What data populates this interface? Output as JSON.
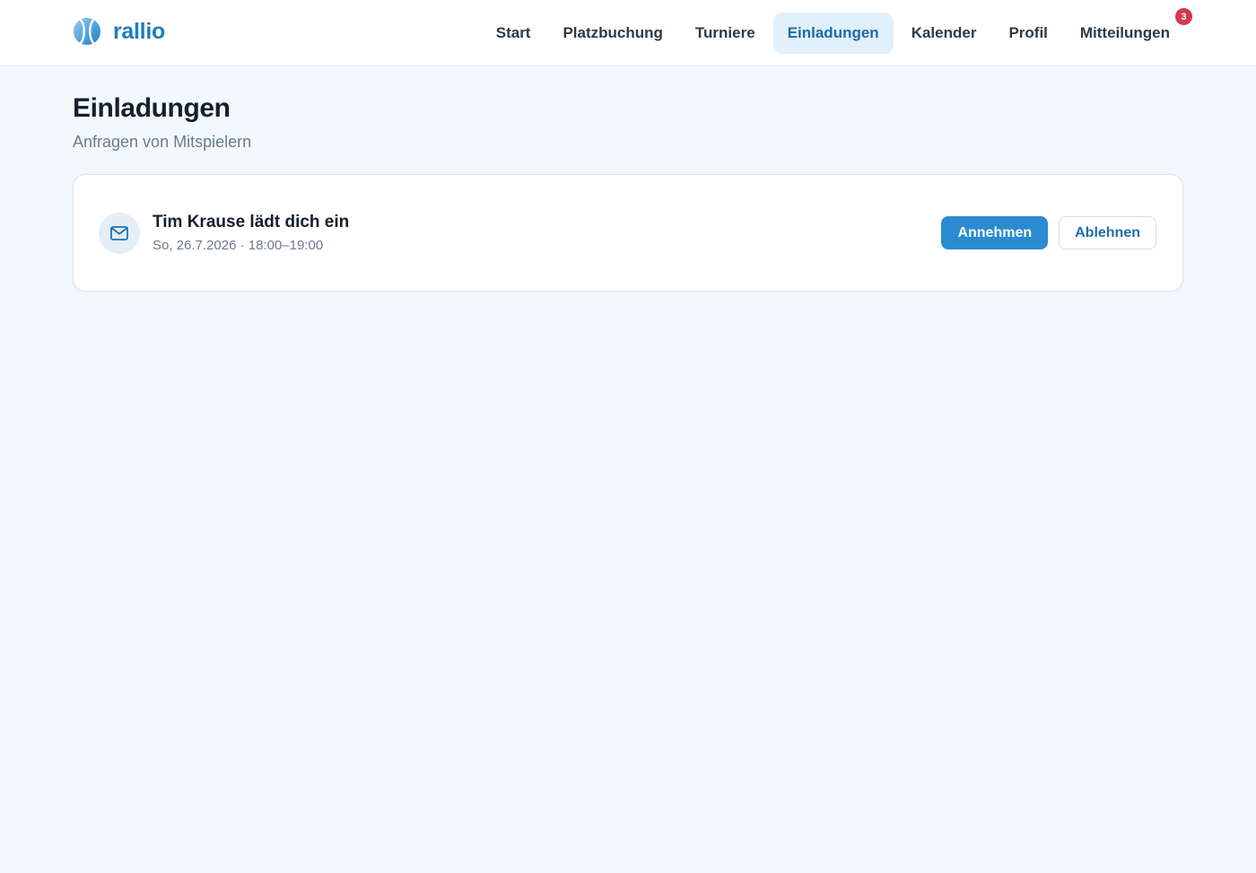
{
  "brand": {
    "name": "rallio",
    "logo_icon": "tennis-ball-icon",
    "accent_color": "#1f7cc2"
  },
  "nav": {
    "items": [
      {
        "label": "Start",
        "active": false
      },
      {
        "label": "Platzbuchung",
        "active": false
      },
      {
        "label": "Turniere",
        "active": false
      },
      {
        "label": "Einladungen",
        "active": true
      },
      {
        "label": "Kalender",
        "active": false
      },
      {
        "label": "Profil",
        "active": false
      },
      {
        "label": "Mitteilungen",
        "active": false,
        "badge": "3"
      }
    ],
    "active_bg": "#e2f0fb",
    "badge_color": "#d3394c"
  },
  "page": {
    "title": "Einladungen",
    "subtitle": "Anfragen von Mitspielern"
  },
  "invitations": [
    {
      "icon": "mail-icon",
      "title": "Tim Krause lädt dich ein",
      "meta": "So, 26.7.2026 · 18:00–19:00",
      "accept_label": "Annehmen",
      "decline_label": "Ablehnen"
    }
  ],
  "colors": {
    "primary": "#2a8bd0",
    "background": "#f3f8fc"
  }
}
